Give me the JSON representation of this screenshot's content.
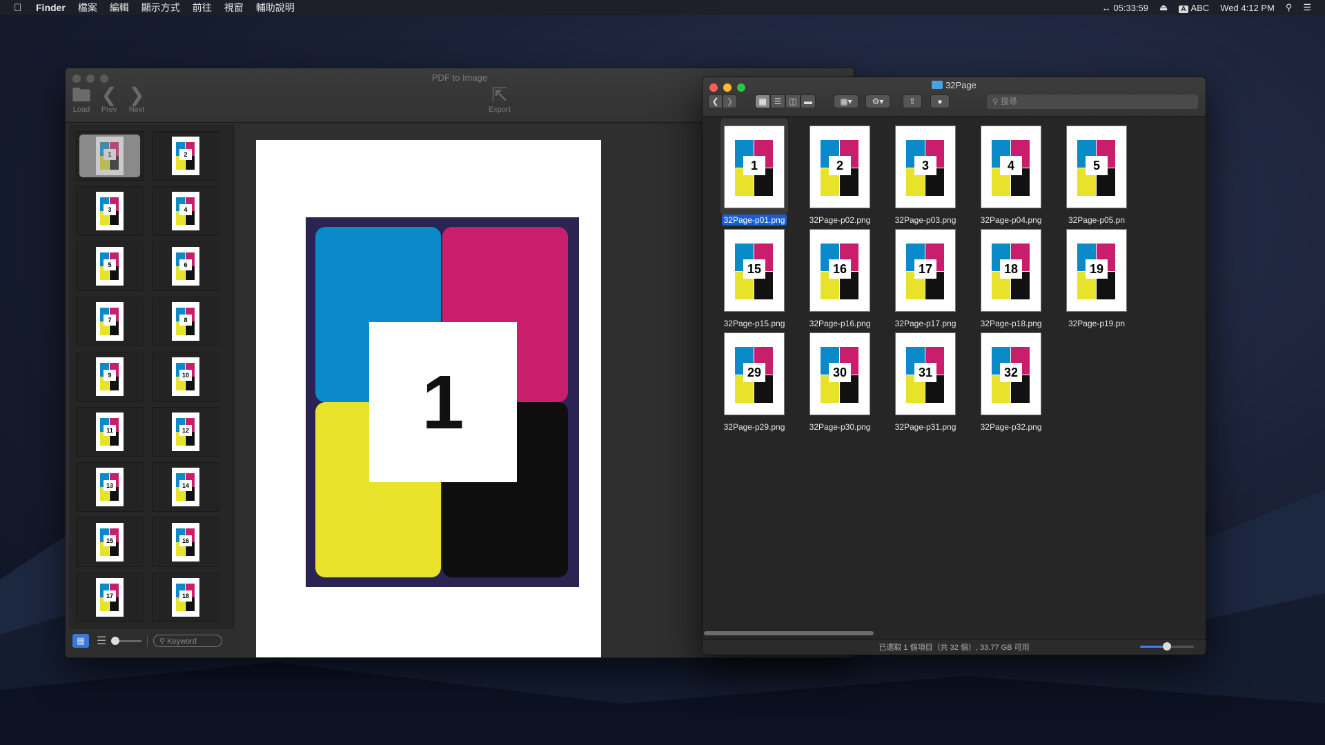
{
  "menubar": {
    "app": "Finder",
    "items": [
      "檔案",
      "編輯",
      "顯示方式",
      "前往",
      "視窗",
      "輔助說明"
    ],
    "clock_timer": "05:33:59",
    "input_source": "ABC",
    "datetime": "Wed 4:12 PM",
    "input_badge": "A"
  },
  "pdf_app": {
    "title": "PDF to Image",
    "toolbar": {
      "load": "Load",
      "prev": "Prev",
      "next": "Next",
      "export": "Export"
    },
    "thumbnails": [
      "1",
      "2",
      "3",
      "4",
      "5",
      "6",
      "7",
      "8",
      "9",
      "10",
      "11",
      "12",
      "13",
      "14",
      "15",
      "16",
      "17",
      "18"
    ],
    "selected_thumbnail": "1",
    "preview_page_number": "1",
    "search_placeholder": "Keyword",
    "colors": {
      "cyan": "#0a8ac8",
      "magenta": "#c81e6c",
      "yellow": "#e8e22a",
      "black": "#0e0e0e",
      "frame": "#2b2352"
    }
  },
  "finder": {
    "title": "32Page",
    "search_placeholder": "搜尋",
    "items": [
      {
        "num": "1",
        "name": "32Page-p01.png"
      },
      {
        "num": "2",
        "name": "32Page-p02.png"
      },
      {
        "num": "3",
        "name": "32Page-p03.png"
      },
      {
        "num": "4",
        "name": "32Page-p04.png"
      },
      {
        "num": "5",
        "name": "32Page-p05.pn"
      },
      {
        "num": "15",
        "name": "32Page-p15.png"
      },
      {
        "num": "16",
        "name": "32Page-p16.png"
      },
      {
        "num": "17",
        "name": "32Page-p17.png"
      },
      {
        "num": "18",
        "name": "32Page-p18.png"
      },
      {
        "num": "19",
        "name": "32Page-p19.pn"
      },
      {
        "num": "29",
        "name": "32Page-p29.png"
      },
      {
        "num": "30",
        "name": "32Page-p30.png"
      },
      {
        "num": "31",
        "name": "32Page-p31.png"
      },
      {
        "num": "32",
        "name": "32Page-p32.png"
      }
    ],
    "selected_item": "32Page-p01.png",
    "status": "已選取 1 個項目（共 32 個）, 33.77 GB 可用",
    "icon_size_level": 0.5,
    "selection_color": "#1a5fd0"
  }
}
